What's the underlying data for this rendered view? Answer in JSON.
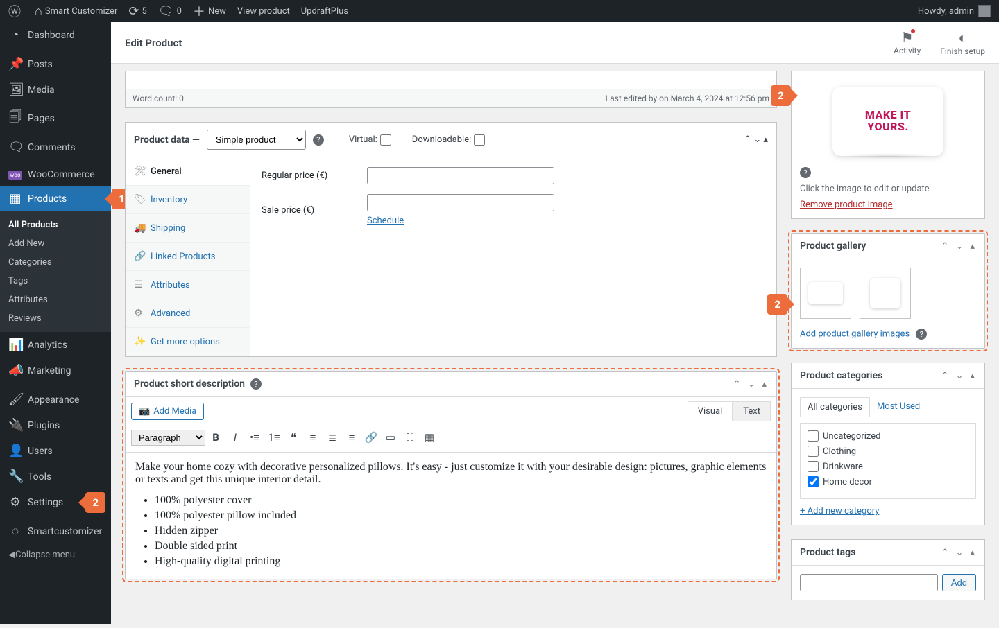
{
  "adminbar": {
    "site_name": "Smart Customizer",
    "updates": "5",
    "comments": "0",
    "new": "New",
    "view_product": "View product",
    "updraft": "UpdraftPlus",
    "howdy": "Howdy, admin"
  },
  "sidebar": {
    "dashboard": "Dashboard",
    "posts": "Posts",
    "media": "Media",
    "pages": "Pages",
    "comments": "Comments",
    "woocommerce": "WooCommerce",
    "products": "Products",
    "submenu": {
      "all": "All Products",
      "add_new": "Add New",
      "categories": "Categories",
      "tags": "Tags",
      "attributes": "Attributes",
      "reviews": "Reviews"
    },
    "analytics": "Analytics",
    "marketing": "Marketing",
    "appearance": "Appearance",
    "plugins": "Plugins",
    "users": "Users",
    "tools": "Tools",
    "settings": "Settings",
    "smartcustomizer": "Smartcustomizer",
    "collapse": "Collapse menu"
  },
  "callouts": {
    "one": "1",
    "two_a": "2",
    "two_b": "2",
    "two_c": "2"
  },
  "topstrip": {
    "title": "Edit Product",
    "activity": "Activity",
    "finish": "Finish setup"
  },
  "editor_frag": {
    "word_count": "Word count: 0",
    "last_edited": "Last edited by on March 4, 2024 at 12:56 pm"
  },
  "product_data": {
    "title": "Product data —",
    "selected_type": "Simple product",
    "virtual": "Virtual:",
    "downloadable": "Downloadable:",
    "tabs": {
      "general": "General",
      "inventory": "Inventory",
      "shipping": "Shipping",
      "linked": "Linked Products",
      "attributes": "Attributes",
      "advanced": "Advanced",
      "more": "Get more options"
    },
    "regular_price": "Regular price (€)",
    "sale_price": "Sale price (€)",
    "schedule": "Schedule"
  },
  "short_desc": {
    "title": "Product short description",
    "add_media": "Add Media",
    "visual": "Visual",
    "text": "Text",
    "style": "Paragraph",
    "body": "Make your home cozy with decorative personalized pillows. It's easy - just customize it with your desirable design: pictures, graphic elements or texts and get this unique interior detail.",
    "bullets": {
      "0": "100% polyester cover",
      "1": "100% polyester pillow included",
      "2": "Hidden zipper",
      "3": "Double sided print",
      "4": "High-quality digital printing"
    }
  },
  "product_image": {
    "pillow_text": "YOURS.",
    "click_hint": "Click the image to edit or update",
    "remove": "Remove product image"
  },
  "gallery": {
    "title": "Product gallery",
    "add": "Add product gallery images"
  },
  "categories": {
    "title": "Product categories",
    "tab_all": "All categories",
    "tab_most": "Most Used",
    "opts": {
      "uncategorized": "Uncategorized",
      "clothing": "Clothing",
      "drinkware": "Drinkware",
      "home_decor": "Home decor"
    },
    "add_new": "+ Add new category"
  },
  "tags": {
    "title": "Product tags",
    "add_btn": "Add"
  }
}
